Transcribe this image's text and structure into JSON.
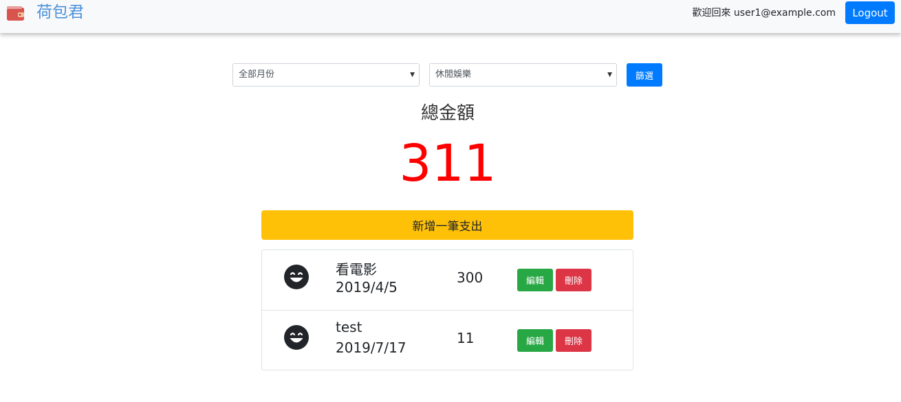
{
  "app": {
    "brand_name": "荷包君",
    "brand_icon": "wallet-icon",
    "welcome_text": "歡迎回來 user1@example.com",
    "logout_label": "Logout"
  },
  "filters": {
    "month_selected": "全部月份",
    "category_selected": "休閒娛樂",
    "filter_label": "篩選"
  },
  "summary": {
    "total_label": "總金額",
    "total_amount": "311"
  },
  "add_expense_label": "新增一筆支出",
  "expenses": [
    {
      "icon": "grinning-face-icon",
      "name": "看電影",
      "date": "2019/4/5",
      "amount": "300",
      "edit_label": "編輯",
      "delete_label": "刪除"
    },
    {
      "icon": "grinning-face-icon",
      "name": "test",
      "date": "2019/7/17",
      "amount": "11",
      "edit_label": "編輯",
      "delete_label": "刪除"
    }
  ],
  "colors": {
    "primary": "#007bff",
    "warning": "#ffc107",
    "success": "#28a745",
    "danger": "#dc3545",
    "total": "#ff0000",
    "brand": "#4a90d9"
  }
}
